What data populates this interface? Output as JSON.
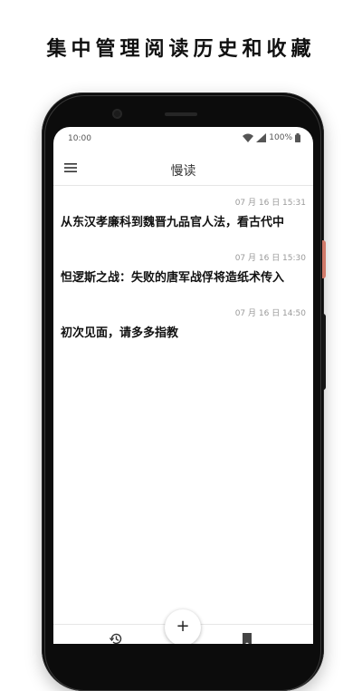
{
  "promo": {
    "headline": "集中管理阅读历史和收藏"
  },
  "statusbar": {
    "time": "10:00",
    "battery": "100%"
  },
  "appbar": {
    "title": "慢读",
    "menu_icon": "menu-icon"
  },
  "articles": [
    {
      "date": "07 月 16 日 15:31",
      "title": "从东汉孝廉科到魏晋九品官人法，看古代中"
    },
    {
      "date": "07 月 16 日 15:30",
      "title": "怛逻斯之战：失败的唐军战俘将造纸术传入"
    },
    {
      "date": "07 月 16 日 14:50",
      "title": "初次见面，请多多指教"
    }
  ],
  "bottom_nav": {
    "fab_label": "+",
    "left_icon": "history-icon",
    "right_icon": "bookmark-icon"
  },
  "colors": {
    "frame": "#0c0c0c",
    "accent_button": "#d07a6a",
    "text": "#111111"
  }
}
